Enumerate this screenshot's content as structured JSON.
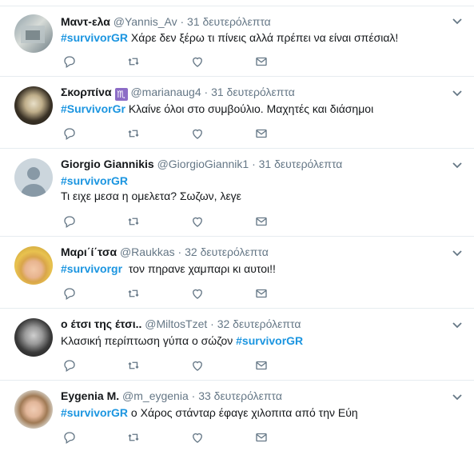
{
  "colors": {
    "hashtag": "#1b95e0",
    "muted": "#657786",
    "border": "#e6ecf0"
  },
  "icons": {
    "reply": "reply-icon",
    "retweet": "retweet-icon",
    "like": "heart-icon",
    "dm": "envelope-icon",
    "menu": "chevron-down-icon"
  },
  "tweets": [
    {
      "name": "Μαντ-ελα",
      "handle": "@Yannis_Av",
      "time": "31 δευτερόλεπτα",
      "text_pre": "",
      "hashtag": "#survivorGR",
      "text_post": " Χάρε δεν ξέρω τι πίνεις αλλά πρέπει να είναι σπέσιαλ!"
    },
    {
      "name": "Σκορπίνα",
      "badge": "♏",
      "handle": "@marianaug4",
      "time": "31 δευτερόλεπτα",
      "text_pre": "",
      "hashtag": "#SurvivorGr",
      "text_post": " Κλαίνε όλοι στο συμβούλιο. Μαχητές και διάσημοι"
    },
    {
      "name": "Giorgio Giannikis",
      "handle": "@GiorgioGiannik1",
      "time": "31 δευτερόλεπτα",
      "text_pre": "",
      "hashtag": "#survivorGR",
      "text_post": "",
      "line2": "Τι ειχε μεσα η ομελετα? Σωζων, λεγε"
    },
    {
      "name": "Μαρι΄ί΄τσα",
      "handle": "@Raukkas",
      "time": "32 δευτερόλεπτα",
      "text_pre": "",
      "hashtag": "#survivorgr",
      "text_post": "  τον πηρανε χαμπαρι κι αυτοι!!"
    },
    {
      "name": "ο έτσι της έτσι..",
      "handle": "@MiltosTzet",
      "time": "32 δευτερόλεπτα",
      "text_pre": "Κλασική περίπτωση γύπα ο σώζον ",
      "hashtag": "#survivorGR",
      "text_post": ""
    },
    {
      "name": "Eygenia M.",
      "handle": "@m_eygenia",
      "time": "33 δευτερόλεπτα",
      "text_pre": "",
      "hashtag": "#survivorGR",
      "text_post": " ο Χάρος στάνταρ έφαγε χιλοπιτα από την Εύη"
    }
  ]
}
